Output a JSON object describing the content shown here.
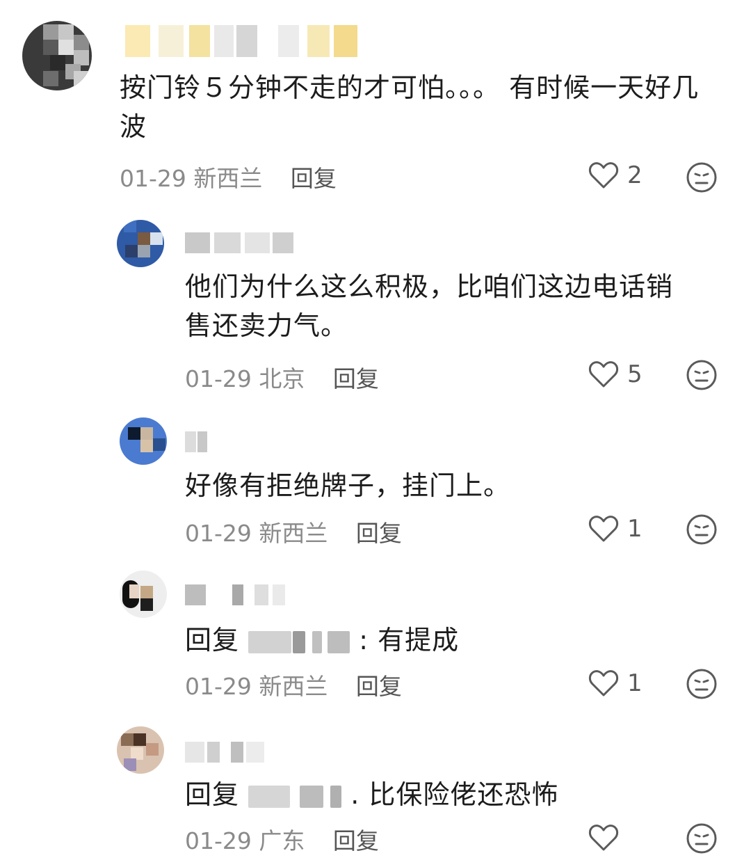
{
  "comments": [
    {
      "text": "按门铃５分钟不走的才可怕。。。 有时候一天好几波",
      "date": "01-29",
      "location": "新西兰",
      "reply_label": "回复",
      "likes": "2"
    },
    {
      "text": "他们为什么这么积极，比咱们这边电话销售还卖力气。",
      "date": "01-29",
      "location": "北京",
      "reply_label": "回复",
      "likes": "5"
    },
    {
      "text": "好像有拒绝牌子，挂门上。",
      "date": "01-29",
      "location": "新西兰",
      "reply_label": "回复",
      "likes": "1"
    },
    {
      "reply_prefix": "回复",
      "text": ": 有提成",
      "date": "01-29",
      "location": "新西兰",
      "reply_label": "回复",
      "likes": "1"
    },
    {
      "reply_prefix": "回复",
      "text": ". 比保险佬还恐怖",
      "date": "01-29",
      "location": "广东",
      "reply_label": "回复",
      "likes": ""
    }
  ],
  "icons": {
    "like": "heart-outline-icon",
    "react": "neutral-face-icon"
  },
  "colors": {
    "text": "#1c1c1c",
    "meta": "#8a8a8a",
    "icon": "#5a5a5a"
  }
}
